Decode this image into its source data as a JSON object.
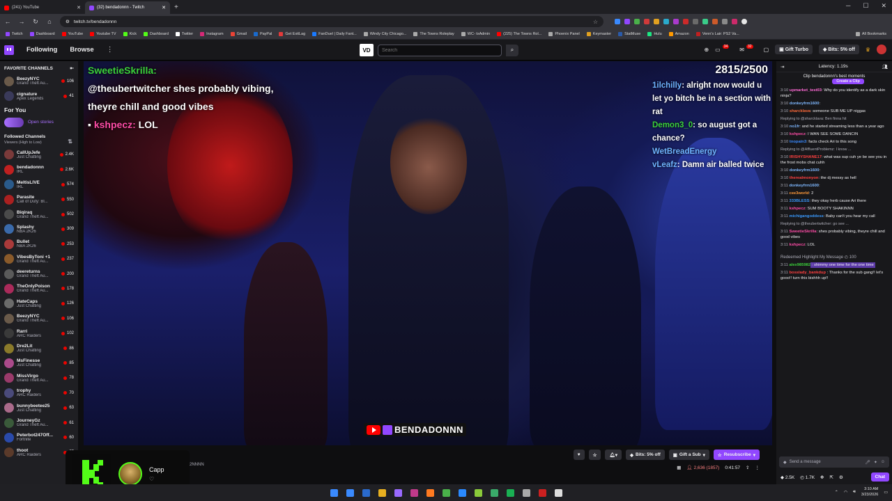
{
  "browser": {
    "tabs": [
      {
        "label": "(241) YouTube",
        "color": "#ff0000",
        "active": false
      },
      {
        "label": "(32) bendadonnn - Twitch",
        "color": "#9147ff",
        "active": true
      }
    ],
    "url": "twitch.tv/bendadonnn",
    "bookmarks": [
      "Twitch",
      "Dashboard",
      "YouTube",
      "Youtube TV",
      "Kick",
      "Dashboard",
      "Twitter",
      "Instagram",
      "Gmail",
      "PayPal",
      "Get ExitLag",
      "FanDuel | Daily Fant...",
      "Windy City Chicago...",
      "The Towns Roleplay",
      "WC- txAdmin",
      "(225) The Towns Rol...",
      "Phoenix Panel",
      "Keymaster",
      "StatMuse",
      "Hulu",
      "Amazon",
      "Venn's Lair: PS2 Va..."
    ],
    "all_bookmarks": "All Bookmarks"
  },
  "nav": {
    "following": "Following",
    "browse": "Browse",
    "search_placeholder": "Search",
    "gift_turbo": "Gift Turbo",
    "bits": "Bits: 5% off",
    "badge_notifs": "34",
    "badge_inbox": "32"
  },
  "sidebar": {
    "favorites_title": "FAVORITE CHANNELS",
    "favorites": [
      {
        "name": "BeezyNYC",
        "cat": "Grand Theft Au...",
        "viewers": "106",
        "color": "#6a5a4a"
      },
      {
        "name": "cignature",
        "cat": "Apex Legends",
        "viewers": "41",
        "color": "#3a3a5a"
      }
    ],
    "for_you": "For You",
    "open_stories": "Open stories",
    "followed_title": "Followed Channels",
    "followed_sub": "Viewers (High to Low)",
    "followed": [
      {
        "name": "CallUpJefe",
        "cat": "Just Chatting",
        "viewers": "2.4K",
        "color": "#7a3a3a"
      },
      {
        "name": "bendadonnn",
        "cat": "IRL",
        "viewers": "2.6K",
        "color": "#c02020"
      },
      {
        "name": "MeltisLIVE",
        "cat": "IRL",
        "viewers": "574",
        "color": "#2a5a8a"
      },
      {
        "name": "Parasite",
        "cat": "Call of Duty: Bl...",
        "viewers": "550",
        "color": "#aa2020"
      },
      {
        "name": "Biqiraq",
        "cat": "Grand Theft Au...",
        "viewers": "502",
        "color": "#4a4a4a"
      },
      {
        "name": "Splashy",
        "cat": "NBA 2K26",
        "viewers": "309",
        "color": "#3a6aaa"
      },
      {
        "name": "Bullet",
        "cat": "NBA 2K26",
        "viewers": "253",
        "color": "#aa3a3a"
      },
      {
        "name": "VibesByToni +1",
        "cat": "Grand Theft Au...",
        "viewers": "237",
        "color": "#8a5a2a"
      },
      {
        "name": "deereturns",
        "cat": "Grand Theft Au...",
        "viewers": "200",
        "color": "#5a5a5a"
      },
      {
        "name": "TheOnlyPoison",
        "cat": "Grand Theft Au...",
        "viewers": "178",
        "color": "#aa2a5a"
      },
      {
        "name": "HateCaps",
        "cat": "Just Chatting",
        "viewers": "126",
        "color": "#6a6a6a"
      },
      {
        "name": "BeezyNYC",
        "cat": "Grand Theft Au...",
        "viewers": "106",
        "color": "#6a5a4a"
      },
      {
        "name": "Rarri",
        "cat": "ARC Raiders",
        "viewers": "102",
        "color": "#3a3a3a"
      },
      {
        "name": "Dre2Lit",
        "cat": "Just Chatting",
        "viewers": "86",
        "color": "#8a7a2a"
      },
      {
        "name": "MsFinesse",
        "cat": "Just Chatting",
        "viewers": "85",
        "color": "#aa4a8a"
      },
      {
        "name": "MissVirgo",
        "cat": "Grand Theft Au...",
        "viewers": "78",
        "color": "#9a3a6a"
      },
      {
        "name": "trophy",
        "cat": "ARC Raiders",
        "viewers": "70",
        "color": "#4a4a7a"
      },
      {
        "name": "bunnybeetee25",
        "cat": "Just Chatting",
        "viewers": "63",
        "color": "#aa6a8a"
      },
      {
        "name": "JourneyGz",
        "cat": "Grand Theft Au...",
        "viewers": "61",
        "color": "#3a5a3a"
      },
      {
        "name": "Peterbot247Off...",
        "cat": "Fortnite",
        "viewers": "60",
        "color": "#2a4aaa"
      },
      {
        "name": "thoot",
        "cat": "ARC Raiders",
        "viewers": "57",
        "color": "#5a3a2a"
      }
    ]
  },
  "video": {
    "overlay_user1": "SweetieSkrilla:",
    "overlay_msg1": "@theubertwitcher shes probably vibing, theyre chill and good vibes",
    "overlay_user2": "kshpecz:",
    "overlay_msg2": " LOL",
    "goal": "2815/2500",
    "right_lines": [
      {
        "user": "1ilchilly",
        "text": ": alright now would u let yo bitch be in a section with rat"
      },
      {
        "user": "Demon3_0",
        "text": ": so august got a chance?"
      },
      {
        "user": "WetBreadEnergy",
        "text": ""
      },
      {
        "user": "vLeafz",
        "text": ": Damn air balled twice"
      }
    ],
    "watermark": "BENDADONNN"
  },
  "info": {
    "channel": "bendadonnn",
    "tail": "2NNNN",
    "bits": "Bits: 5% off",
    "gift_sub": "Gift a Sub",
    "resubscribe": "Resubscribe",
    "viewers": "2,636 (1857)",
    "uptime": "0:41:57"
  },
  "kick": {
    "name": "Capp"
  },
  "chat": {
    "latency": "Latency: 1.19s",
    "clip_text": "Clip bendadonnn's best moments",
    "clip_button": "Create a Clip",
    "messages": [
      {
        "time": "3:10",
        "user": "upmarket_test03",
        "color": "#ff6ad5",
        "text": ": Why do you identify as a dark skin ninja?"
      },
      {
        "time": "3:10",
        "user": "donkeyfrm1600",
        "color": "#7fb8ff",
        "text": ":"
      },
      {
        "time": "3:10",
        "user": "sharcklava",
        "color": "#ff6a3a",
        "text": ": someone SUB ME UP niggas"
      },
      {
        "time": "",
        "user": "",
        "color": "#adadb8",
        "text": "Replying to @sharcklava: Ben finna hit"
      },
      {
        "time": "3:10",
        "user": "no1fr",
        "color": "#7fb8ff",
        "text": ": and he started streaming less than a year ago"
      },
      {
        "time": "3:10",
        "user": "kshpecz",
        "color": "#ff4ca7",
        "text": ": I WAN SEE SOME DANCIN"
      },
      {
        "time": "3:10",
        "user": "tnopain3",
        "color": "#3a8aff",
        "text": ": facts check Ari to this song"
      },
      {
        "time": "",
        "user": "",
        "color": "#adadb8",
        "text": "Replying to @AffluentProblemz: I know ..."
      },
      {
        "time": "3:10",
        "user": "IRISHYSHANE17",
        "color": "#ff4040",
        "text": ": what was sup cuh ye be see you in the frost mobs chat cuhh"
      },
      {
        "time": "3:10",
        "user": "donkeyfrm1600",
        "color": "#7fb8ff",
        "text": ":"
      },
      {
        "time": "3:10",
        "user": "therealmonyon",
        "color": "#ff4040",
        "text": ": the dj messy as hell"
      },
      {
        "time": "3:11",
        "user": "donkeyfrm1600",
        "color": "#7fb8ff",
        "text": ":"
      },
      {
        "time": "3:11",
        "user": "cee3world",
        "color": "#ff9a3a",
        "text": ": 2"
      },
      {
        "time": "3:11",
        "user": "333BLESS",
        "color": "#3a9aff",
        "text": ": they okay herb cause Ari there"
      },
      {
        "time": "3:11",
        "user": "kshpecz",
        "color": "#ff4ca7",
        "text": ": SUM BOOTY SHAKINNN"
      },
      {
        "time": "3:11",
        "user": "michigangoddess",
        "color": "#3a9aff",
        "text": ": Baby can't you hear my call"
      },
      {
        "time": "",
        "user": "",
        "color": "#adadb8",
        "text": "Replying to @theubertwitcher: go see ..."
      },
      {
        "time": "3:11",
        "user": "SweetieSkrilla",
        "color": "#ff4ca7",
        "text": ": shes probably vibing, theyre chill and good vibes"
      },
      {
        "time": "3:11",
        "user": "kshpecz",
        "color": "#ff4ca7",
        "text": ": LOL"
      }
    ],
    "redeem_label": "Redeemed Highlight My Message",
    "redeem_cost": "100",
    "highlight_time": "3:11",
    "highlight_user": "alex985982",
    "highlight_text": ": shimmy one time for the one time",
    "last_time": "3:11",
    "last_user": "bosslady_bankdup",
    "last_text": ": Thanks for the sub gang!! let's gooo!! turn this bishhh up!!",
    "input_placeholder": "Send a message",
    "points": "2.5K",
    "bits_count": "1.7K",
    "chat_button": "Chat"
  },
  "taskbar": {
    "icons": [
      "#3a8aff",
      "#2a6acc",
      "#e8b020",
      "#9a6aff",
      "#c03a8a",
      "#ff7a20",
      "#4ab04a",
      "#2a8aff",
      "#8aca3a",
      "#3aaa6a",
      "#1ab053",
      "#aaaaaa",
      "#cc2020",
      "#dddddd"
    ],
    "time": "3:10 AM",
    "date": "3/23/2026"
  }
}
